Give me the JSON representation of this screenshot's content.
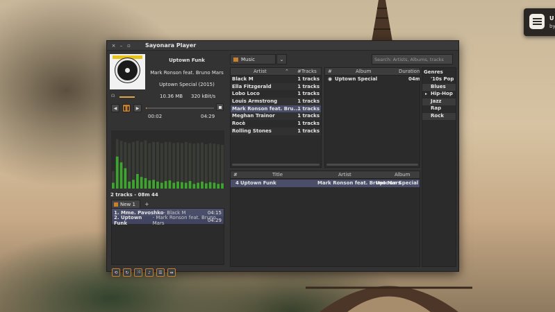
{
  "notification": {
    "title": "U",
    "subtitle": "by"
  },
  "window": {
    "title": "Sayonara Player",
    "controls": [
      "×",
      "–",
      "▫"
    ]
  },
  "now_playing": {
    "title": "Uptown Funk",
    "artist": "Mark Ronson feat. Bruno Mars",
    "album": "Uptown Special (2015)",
    "filesize": "10.36 MB",
    "bitrate": "320 kBit/s",
    "current_time": "00:02",
    "total_time": "04:29",
    "progress_fraction": 0.01,
    "volume_label": "☊",
    "volume_fraction": 0.9
  },
  "spectrum": {
    "levels": [
      0.1,
      0.55,
      0.45,
      0.35,
      0.12,
      0.15,
      0.25,
      0.2,
      0.18,
      0.14,
      0.15,
      0.12,
      0.1,
      0.13,
      0.14,
      0.1,
      0.12,
      0.11,
      0.1,
      0.13,
      0.08,
      0.1,
      0.12,
      0.09,
      0.11,
      0.1,
      0.08,
      0.09
    ],
    "peaks": [
      0.3,
      0.85,
      0.82,
      0.8,
      0.78,
      0.8,
      0.82,
      0.8,
      0.83,
      0.78,
      0.8,
      0.8,
      0.78,
      0.8,
      0.8,
      0.78,
      0.79,
      0.78,
      0.8,
      0.78,
      0.77,
      0.78,
      0.79,
      0.76,
      0.78,
      0.77,
      0.76,
      0.75
    ]
  },
  "playlist": {
    "summary": "2 tracks - 08m 44",
    "tab_label": "New 1",
    "add_label": "+",
    "items": [
      {
        "name": "1. Mme. Pavoshko",
        "artist": " - Black M",
        "duration": "04:15"
      },
      {
        "name": "2. Uptown Funk",
        "artist": " - Mark Ronson feat. Bruno Mars",
        "duration": "04:29"
      }
    ]
  },
  "library": {
    "source": "Music",
    "search_placeholder": "Search: Artists, Albums, tracks",
    "artists_header": {
      "name": "Artist",
      "tracks": "#Tracks"
    },
    "artists": [
      {
        "name": "Black M",
        "tracks": "1 tracks"
      },
      {
        "name": "Ella Fitzgerald",
        "tracks": "1 tracks"
      },
      {
        "name": "Lobo Loco",
        "tracks": "1 tracks"
      },
      {
        "name": "Louis Armstrong",
        "tracks": "1 tracks"
      },
      {
        "name": "Mark Ronson feat. Bru...",
        "tracks": "1 tracks"
      },
      {
        "name": "Meghan Trainor",
        "tracks": "1 tracks"
      },
      {
        "name": "Rocè",
        "tracks": "1 tracks"
      },
      {
        "name": "Rolling Stones",
        "tracks": "1 tracks"
      }
    ],
    "albums_header": {
      "num": "#",
      "album": "Album",
      "duration": "Duration"
    },
    "albums": [
      {
        "name": "Uptown Special",
        "duration": "04m"
      }
    ],
    "genres_header": "Genres",
    "genres": [
      "'10s Pop",
      "Blues",
      "Hip-Hop",
      "Jazz",
      "Rap",
      "Rock"
    ],
    "tracks_header": {
      "num": "#",
      "title": "Title",
      "artist": "Artist",
      "album": "Album"
    },
    "tracks": [
      {
        "num": "4",
        "title": "Uptown Funk",
        "artist": "Mark Ronson feat. Bruno Mars",
        "album": "Uptown Special"
      }
    ]
  },
  "colors": {
    "accent": "#c8802f",
    "selection": "#4a4e69",
    "spectrum_low": "#3fa32f",
    "spectrum_peak": "#6a7a5a"
  }
}
